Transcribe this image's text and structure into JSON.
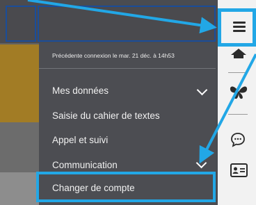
{
  "menu": {
    "last_connection": "Précédente connexion le mar. 21 déc. à 14h53",
    "items": [
      {
        "label": "Mes données",
        "expandable": true
      },
      {
        "label": "Saisie du cahier de textes",
        "expandable": false
      },
      {
        "label": "Appel et suivi",
        "expandable": false
      },
      {
        "label": "Communication",
        "expandable": true
      }
    ],
    "switch_account": "Changer de compte"
  },
  "iconbar": {
    "icons": [
      "hamburger-menu-icon",
      "home-icon",
      "butterfly-icon",
      "chat-icon",
      "contact-card-icon"
    ]
  },
  "colors": {
    "highlight": "#22a7e6",
    "panel": "#4c4d52",
    "iconbar": "#f2f2f2"
  }
}
